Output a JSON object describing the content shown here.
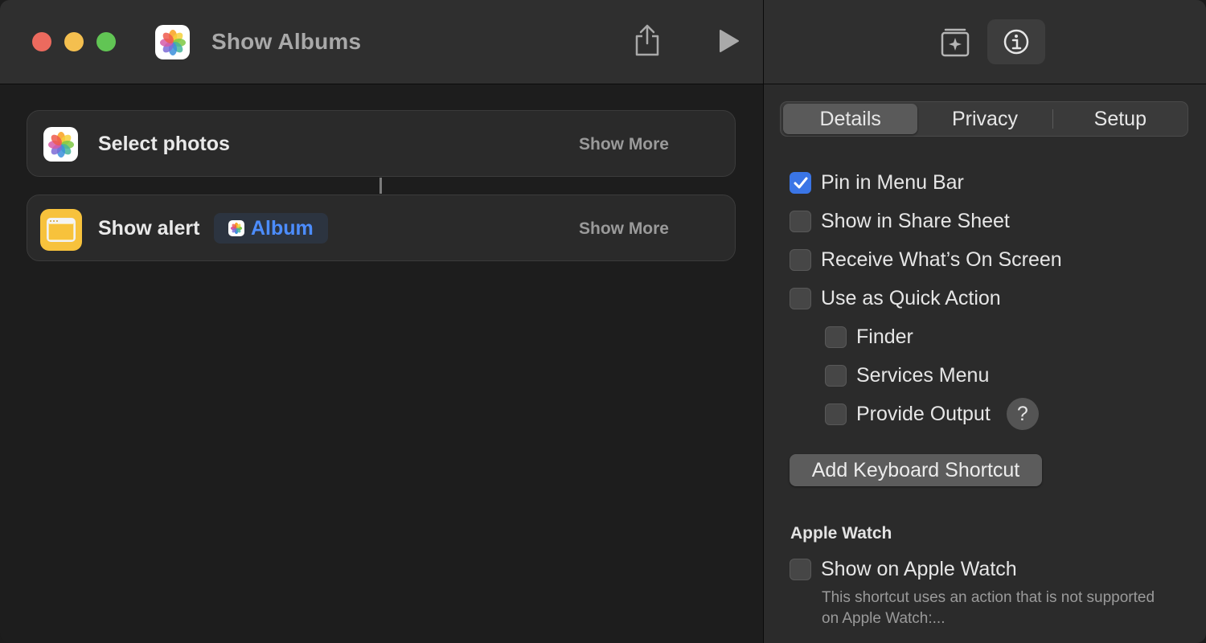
{
  "window": {
    "title": "Show Albums"
  },
  "toolbar": {
    "share_icon": "share-icon",
    "run_icon": "play-icon"
  },
  "actions": [
    {
      "label": "Select photos",
      "show_more": "Show More",
      "icon": "photos-icon"
    },
    {
      "label": "Show alert",
      "variable": "Album",
      "show_more": "Show More",
      "icon": "alert-icon"
    }
  ],
  "inspector": {
    "library_icon": "action-library-icon",
    "info_icon": "info-icon",
    "tabs": [
      {
        "label": "Details",
        "active": true
      },
      {
        "label": "Privacy",
        "active": false
      },
      {
        "label": "Setup",
        "active": false
      }
    ],
    "options": [
      {
        "label": "Pin in Menu Bar",
        "checked": true
      },
      {
        "label": "Show in Share Sheet",
        "checked": false
      },
      {
        "label": "Receive What’s On Screen",
        "checked": false
      },
      {
        "label": "Use as Quick Action",
        "checked": false
      }
    ],
    "sub_options": [
      {
        "label": "Finder",
        "checked": false
      },
      {
        "label": "Services Menu",
        "checked": false
      },
      {
        "label": "Provide Output",
        "checked": false
      }
    ],
    "help_label": "?",
    "keyboard_button": "Add Keyboard Shortcut",
    "apple_watch": {
      "heading": "Apple Watch",
      "option": "Show on Apple Watch",
      "checked": false,
      "note": "This shortcut uses an action that is not supported on Apple Watch:..."
    }
  },
  "colors": {
    "accent": "#3a75e6",
    "variable": "#4c8dff",
    "close": "#ec6a5e",
    "minimize": "#f4bf4f",
    "maximize": "#61c554"
  }
}
